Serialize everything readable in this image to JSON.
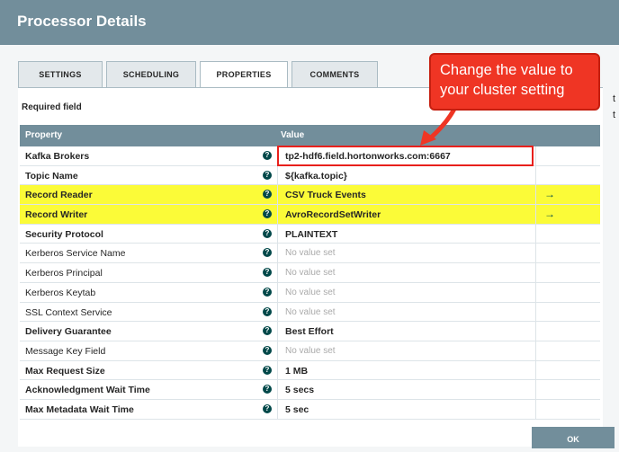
{
  "dialog": {
    "title": "Processor Details"
  },
  "tabs": [
    {
      "label": "SETTINGS"
    },
    {
      "label": "SCHEDULING"
    },
    {
      "label": "PROPERTIES"
    },
    {
      "label": "COMMENTS"
    }
  ],
  "active_tab": "PROPERTIES",
  "required_label": "Required field",
  "table": {
    "headers": {
      "property": "Property",
      "value": "Value"
    },
    "rows": [
      {
        "name": "Kafka Brokers",
        "required": true,
        "value": "tp2-hdf6.field.hortonworks.com:6667",
        "empty": false,
        "highlight": false,
        "goto": false
      },
      {
        "name": "Topic Name",
        "required": true,
        "value": "${kafka.topic}",
        "empty": false,
        "highlight": false,
        "goto": false
      },
      {
        "name": "Record Reader",
        "required": true,
        "value": "CSV Truck Events",
        "empty": false,
        "highlight": true,
        "goto": true
      },
      {
        "name": "Record Writer",
        "required": true,
        "value": "AvroRecordSetWriter",
        "empty": false,
        "highlight": true,
        "goto": true
      },
      {
        "name": "Security Protocol",
        "required": true,
        "value": "PLAINTEXT",
        "empty": false,
        "highlight": false,
        "goto": false
      },
      {
        "name": "Kerberos Service Name",
        "required": false,
        "value": "No value set",
        "empty": true,
        "highlight": false,
        "goto": false
      },
      {
        "name": "Kerberos Principal",
        "required": false,
        "value": "No value set",
        "empty": true,
        "highlight": false,
        "goto": false
      },
      {
        "name": "Kerberos Keytab",
        "required": false,
        "value": "No value set",
        "empty": true,
        "highlight": false,
        "goto": false
      },
      {
        "name": "SSL Context Service",
        "required": false,
        "value": "No value set",
        "empty": true,
        "highlight": false,
        "goto": false
      },
      {
        "name": "Delivery Guarantee",
        "required": true,
        "value": "Best Effort",
        "empty": false,
        "highlight": false,
        "goto": false
      },
      {
        "name": "Message Key Field",
        "required": false,
        "value": "No value set",
        "empty": true,
        "highlight": false,
        "goto": false
      },
      {
        "name": "Max Request Size",
        "required": true,
        "value": "1 MB",
        "empty": false,
        "highlight": false,
        "goto": false
      },
      {
        "name": "Acknowledgment Wait Time",
        "required": true,
        "value": "5 secs",
        "empty": false,
        "highlight": false,
        "goto": false
      },
      {
        "name": "Max Metadata Wait Time",
        "required": true,
        "value": "5 sec",
        "empty": false,
        "highlight": false,
        "goto": false
      }
    ]
  },
  "annotation": {
    "text": "Change the value to your cluster setting"
  },
  "help_icon_glyph": "?",
  "goto_icon_glyph": "→",
  "ok_button": "OK",
  "colors": {
    "header": "#728e9b",
    "highlight": "#fbfb38",
    "callout": "#ef3524"
  }
}
